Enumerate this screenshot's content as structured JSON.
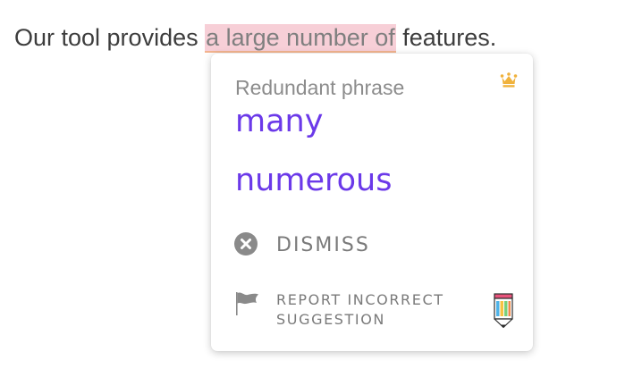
{
  "editor": {
    "text_before": "Our tool provides ",
    "highlighted_text": "a large number of",
    "text_after": " features."
  },
  "popup": {
    "title": "Redundant phrase",
    "premium_icon": "crown-icon",
    "suggestions": [
      "many",
      "numerous"
    ],
    "dismiss_label": "DISMISS",
    "dismiss_icon": "close-circle-icon",
    "report_label": "REPORT INCORRECT SUGGESTION",
    "report_icon": "flag-icon",
    "brand_icon": "pencil-logo-icon"
  },
  "colors": {
    "suggestion": "#6b39e9",
    "highlight_bg": "#f7cfd7",
    "underline": "#f3b48f",
    "crown": "#f0b23c",
    "icon_gray": "#8a8a8a"
  }
}
